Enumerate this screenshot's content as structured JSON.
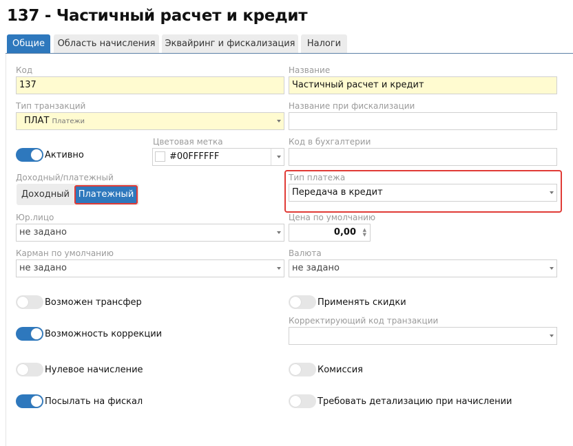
{
  "title": "137 - Частичный расчет и кредит",
  "tabs": [
    "Общие",
    "Область начисления",
    "Эквайринг и фискализация",
    "Налоги"
  ],
  "fields": {
    "code": {
      "label": "Код",
      "value": "137"
    },
    "name": {
      "label": "Название",
      "value": "Частичный расчет и кредит"
    },
    "tx_type": {
      "label": "Тип транзакций",
      "value": "ПЛАТ",
      "sub": "Платежи"
    },
    "fiscal_name": {
      "label": "Название при фискализации",
      "value": ""
    },
    "active": {
      "label": "Активно",
      "on": true
    },
    "color": {
      "label": "Цветовая метка",
      "value": "#00FFFFFF"
    },
    "acc_code": {
      "label": "Код в бухгалтерии",
      "value": ""
    },
    "income_payment": {
      "label": "Доходный/платежный",
      "options": [
        "Доходный",
        "Платежный"
      ],
      "selected": "Платежный"
    },
    "payment_type": {
      "label": "Тип платежа",
      "value": "Передача в кредит"
    },
    "legal": {
      "label": "Юр.лицо",
      "value": "не задано"
    },
    "price": {
      "label": "Цена по умолчанию",
      "value": "0,00"
    },
    "pocket": {
      "label": "Карман по умолчанию",
      "value": "не задано"
    },
    "currency": {
      "label": "Валюта",
      "value": "не задано"
    },
    "transfer": {
      "label": "Возможен трансфер",
      "on": false
    },
    "discounts": {
      "label": "Применять скидки",
      "on": false
    },
    "correction": {
      "label": "Возможность коррекции",
      "on": true
    },
    "corr_code": {
      "label": "Корректирующий код транзакции",
      "value": ""
    },
    "zero": {
      "label": "Нулевое начисление",
      "on": false
    },
    "commission": {
      "label": "Комиссия",
      "on": false
    },
    "send_fiscal": {
      "label": "Посылать на фискал",
      "on": true
    },
    "detail": {
      "label": "Требовать детализацию при начислении",
      "on": false
    }
  },
  "colors": {
    "accent": "#2e78bd",
    "highlight": "#e03a35",
    "required_bg": "#fffbd0"
  }
}
